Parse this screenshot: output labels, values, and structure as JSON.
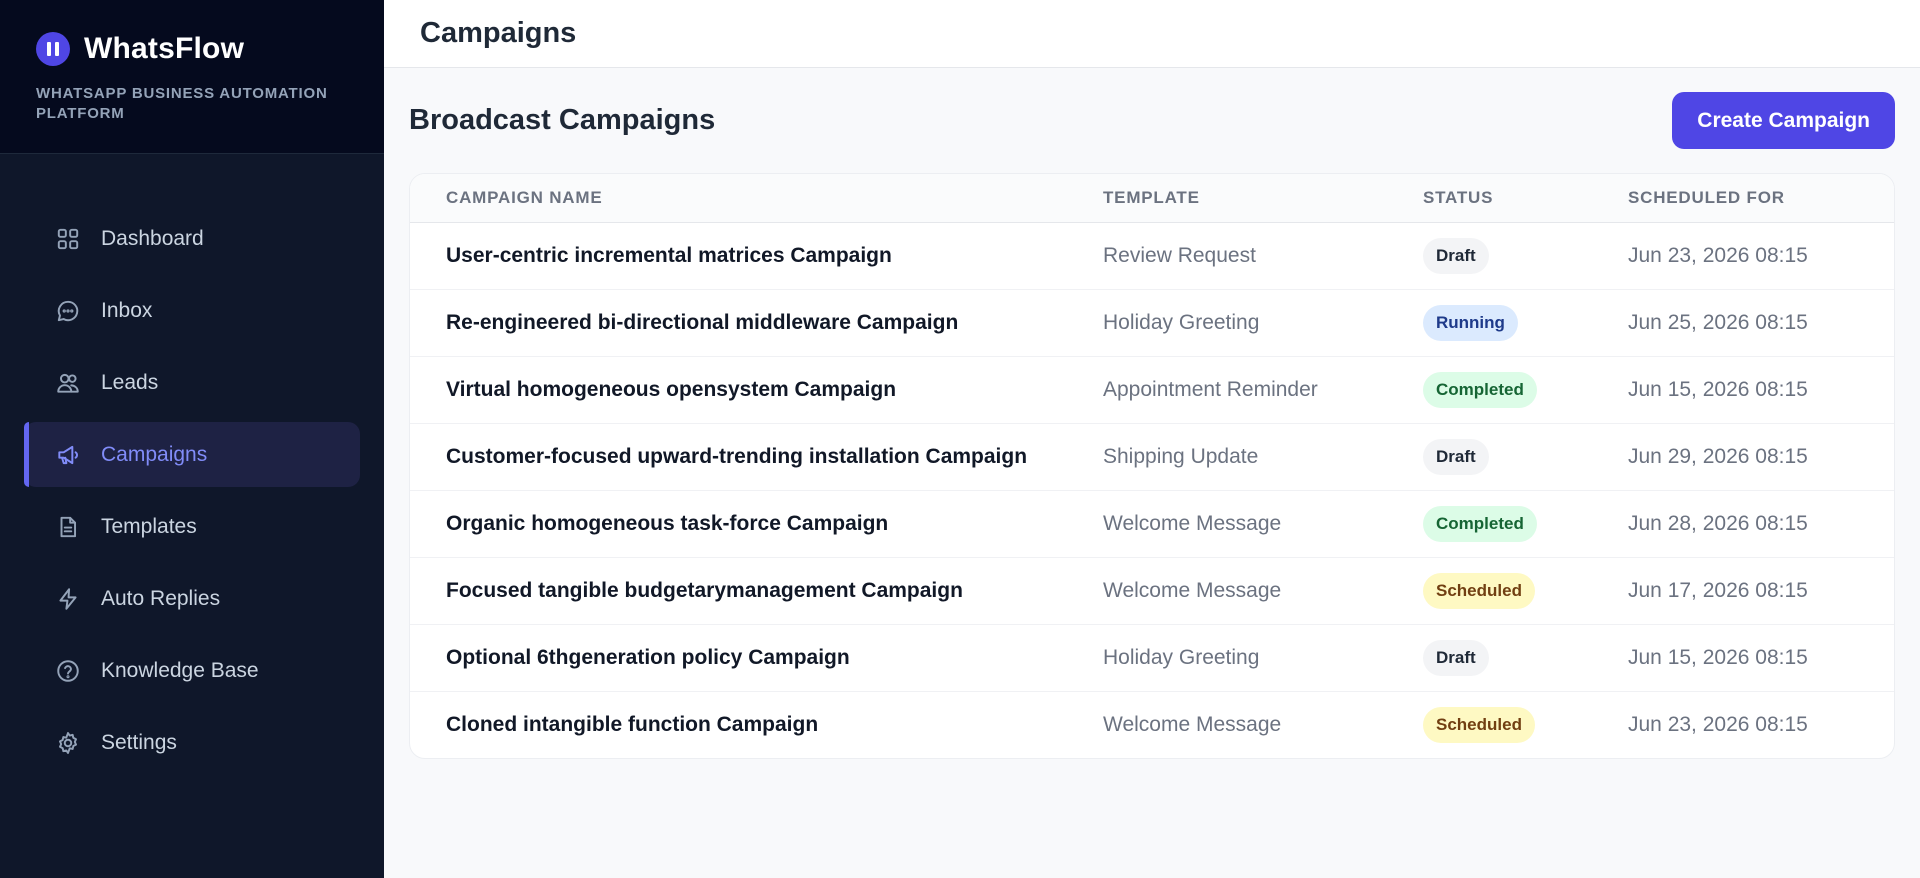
{
  "brand": {
    "name": "WhatsFlow",
    "subtitle": "WHATSAPP BUSINESS AUTOMATION PLATFORM"
  },
  "sidebar": {
    "items": [
      {
        "label": "Dashboard",
        "icon": "grid-icon",
        "active": false
      },
      {
        "label": "Inbox",
        "icon": "chat-bubble-icon",
        "active": false
      },
      {
        "label": "Leads",
        "icon": "users-icon",
        "active": false
      },
      {
        "label": "Campaigns",
        "icon": "megaphone-icon",
        "active": true
      },
      {
        "label": "Templates",
        "icon": "document-icon",
        "active": false
      },
      {
        "label": "Auto Replies",
        "icon": "lightning-icon",
        "active": false
      },
      {
        "label": "Knowledge Base",
        "icon": "question-circle-icon",
        "active": false
      },
      {
        "label": "Settings",
        "icon": "gear-icon",
        "active": false
      }
    ]
  },
  "header": {
    "title": "Campaigns"
  },
  "main": {
    "section_title": "Broadcast Campaigns",
    "create_button": "Create Campaign",
    "table": {
      "columns": [
        "CAMPAIGN NAME",
        "TEMPLATE",
        "STATUS",
        "SCHEDULED FOR"
      ],
      "rows": [
        {
          "name": "User-centric incremental matrices Campaign",
          "template": "Review Request",
          "status": "Draft",
          "scheduled": "Jun 23, 2026 08:15"
        },
        {
          "name": "Re-engineered bi-directional middleware Campaign",
          "template": "Holiday Greeting",
          "status": "Running",
          "scheduled": "Jun 25, 2026 08:15"
        },
        {
          "name": "Virtual homogeneous opensystem Campaign",
          "template": "Appointment Reminder",
          "status": "Completed",
          "scheduled": "Jun 15, 2026 08:15"
        },
        {
          "name": "Customer-focused upward-trending installation Campaign",
          "template": "Shipping Update",
          "status": "Draft",
          "scheduled": "Jun 29, 2026 08:15"
        },
        {
          "name": "Organic homogeneous task-force Campaign",
          "template": "Welcome Message",
          "status": "Completed",
          "scheduled": "Jun 28, 2026 08:15"
        },
        {
          "name": "Focused tangible budgetarymanagement Campaign",
          "template": "Welcome Message",
          "status": "Scheduled",
          "scheduled": "Jun 17, 2026 08:15"
        },
        {
          "name": "Optional 6thgeneration policy Campaign",
          "template": "Holiday Greeting",
          "status": "Draft",
          "scheduled": "Jun 15, 2026 08:15"
        },
        {
          "name": "Cloned intangible function Campaign",
          "template": "Welcome Message",
          "status": "Scheduled",
          "scheduled": "Jun 23, 2026 08:15"
        }
      ]
    }
  },
  "colors": {
    "accent": "#4f46e5",
    "sidebar_bg": "#0f172a",
    "status_draft": "#f3f4f6",
    "status_running": "#dbeafe",
    "status_completed": "#dcfce7",
    "status_scheduled": "#fef9c3"
  }
}
